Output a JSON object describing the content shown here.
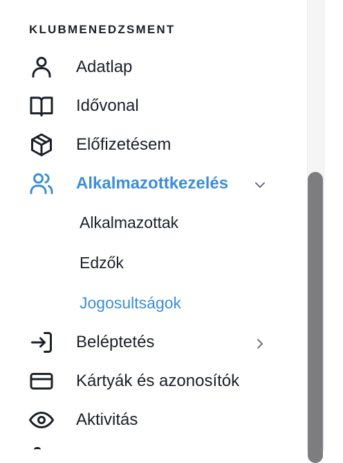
{
  "section": {
    "title": "KLUBMENEDZSMENT"
  },
  "nav": {
    "items": [
      {
        "label": "Adatlap",
        "icon": "user-icon"
      },
      {
        "label": "Idővonal",
        "icon": "book-open-icon"
      },
      {
        "label": "Előfizetésem",
        "icon": "package-icon"
      },
      {
        "label": "Alkalmazottkezelés",
        "icon": "users-icon",
        "active": true,
        "expanded": true
      },
      {
        "label": "Beléptetés",
        "icon": "log-in-icon"
      },
      {
        "label": "Kártyák és azonosítók",
        "icon": "credit-card-icon"
      },
      {
        "label": "Aktivitás",
        "icon": "eye-icon"
      }
    ],
    "subitems": [
      {
        "label": "Alkalmazottak"
      },
      {
        "label": "Edzők"
      },
      {
        "label": "Jogosultságok",
        "active": true
      }
    ]
  },
  "colors": {
    "accent": "#3a8ed8",
    "text": "#1b1f27",
    "muted": "#6b717c",
    "scrollbar": "#7d7d7f"
  }
}
